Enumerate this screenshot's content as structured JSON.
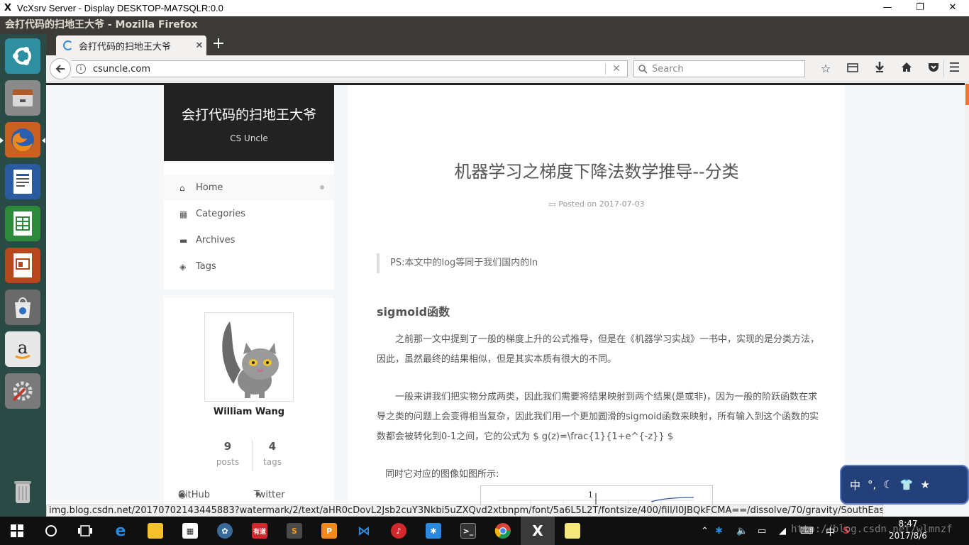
{
  "window": {
    "title": "VcXsrv Server - Display DESKTOP-MA7SQLR:0.0",
    "minimize": "—",
    "restore": "❐",
    "close": "✕"
  },
  "firefox": {
    "title": "会打代码的扫地王大爷 - Mozilla Firefox"
  },
  "tab": {
    "label": "会打代码的扫地王大爷",
    "close": "✕",
    "new_tab": "+"
  },
  "nav": {
    "url": "csuncle.com",
    "search_placeholder": "Search",
    "info_glyph": "i",
    "clear_glyph": "✕"
  },
  "site": {
    "title": "会打代码的扫地王大爷",
    "subtitle": "CS Uncle",
    "menu": [
      {
        "label": "Home",
        "icon": "home-icon"
      },
      {
        "label": "Categories",
        "icon": "grid-icon"
      },
      {
        "label": "Archives",
        "icon": "archive-icon"
      },
      {
        "label": "Tags",
        "icon": "tags-icon"
      }
    ],
    "author": "William Wang",
    "stats": [
      {
        "count": "9",
        "label": "posts"
      },
      {
        "count": "4",
        "label": "tags"
      }
    ],
    "links": [
      {
        "label": "GitHub",
        "icon": "github-icon"
      },
      {
        "label": "Twitter",
        "icon": "twitter-icon"
      }
    ]
  },
  "post": {
    "title": "机器学习之梯度下降法数学推导--分类",
    "meta": "Posted on 2017-07-03",
    "quote": "PS:本文中的log等同于我们国内的ln",
    "section": "sigmoid函数",
    "para1": "之前那一文中提到了一般的梯度上升的公式推导，但是在《机器学习实战》一书中，实现的是分类方法，因此，虽然最终的结果相似，但是其实本质有很大的不同。",
    "para2": "一般来讲我们把实物分成两类，因此我们需要将结果映射到两个结果(是或非)，因为一般的阶跃函数在求导之类的问题上会变得相当复杂，因此我们用一个更加圆滑的sigmoid函数来映射，所有输入到这个函数的实数都会被转化到0-1之间，它的公式为 $ g(z)=\\frac{1}{1+e^{-z}} $",
    "para3": "同时它对应的图像如图所示:",
    "figure_label": "1"
  },
  "statusbar": {
    "text": "img.blog.csdn.net/20170702143445883?watermark/2/text/aHR0cDovL2Jsb2cuY3Nkbi5uZXQvd2xtbnpm/font/5a6L5L2T/fontsize/400/fill/I0JBQkFCMA==/dissolve/70/gravity/SouthEast"
  },
  "ime": {
    "items": [
      "中",
      "°,",
      "☾",
      "👕",
      "★"
    ]
  },
  "taskbar": {
    "apps": [
      "start",
      "cortana",
      "task-view",
      "edge",
      "file-explorer",
      "store",
      "app",
      "youdao",
      "sublime",
      "pdf",
      "vscode",
      "netease-music",
      "app-blue",
      "terminal",
      "chrome",
      "vcxsrv",
      "notes"
    ],
    "youdao_label": "有道",
    "time": "8:47",
    "date": "2017/8/6",
    "ime_lang": "中",
    "tray_badge": "S"
  },
  "watermark": "http://blog.csdn.net/wlmnzf"
}
